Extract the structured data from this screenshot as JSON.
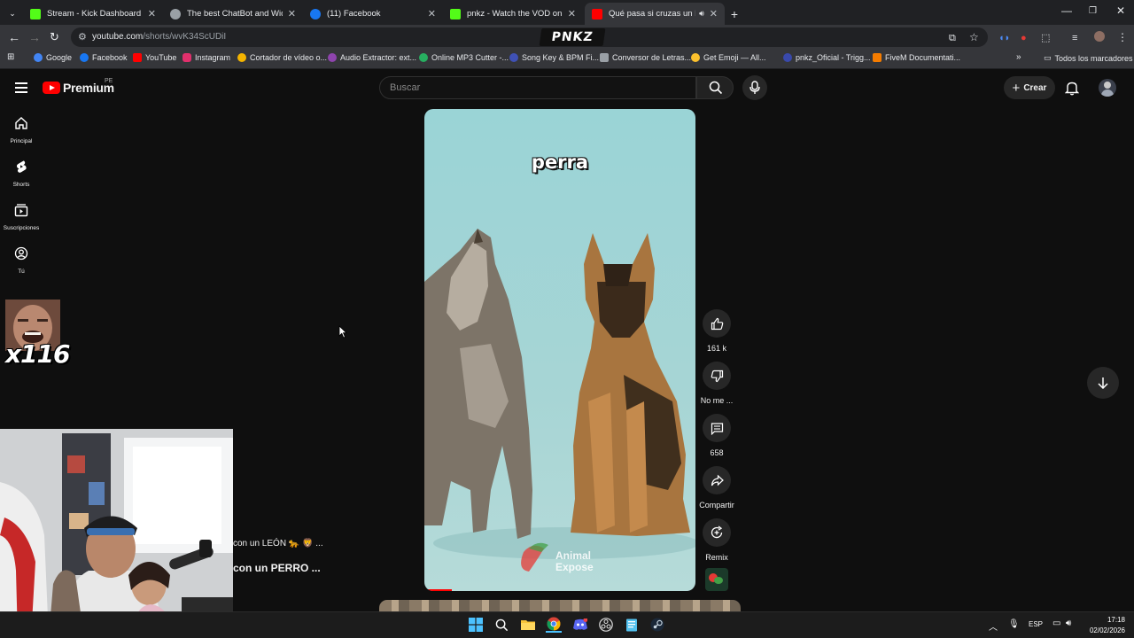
{
  "browser": {
    "tabs": [
      {
        "title": "Stream - Kick Dashboard",
        "icon": "kick-icon",
        "color": "#53fc18"
      },
      {
        "title": "The best ChatBot and Widgets",
        "icon": "botrix-icon",
        "color": "#9aa0a6"
      },
      {
        "title": "(11) Facebook",
        "icon": "facebook-icon",
        "color": "#1877f2"
      },
      {
        "title": "pnkz - Watch the VOD on Kick",
        "icon": "kick-icon",
        "color": "#53fc18"
      },
      {
        "title": "Qué pasa si cruzas un LOBO",
        "icon": "youtube-icon",
        "color": "#ff0000"
      }
    ],
    "new_tab": "+",
    "address": {
      "host": "youtube.com",
      "path": "/shorts/wvK34ScUDiI"
    },
    "overlay_logo": "PNKZ",
    "bookmarks": [
      {
        "label": "Google",
        "color": "#4285f4"
      },
      {
        "label": "Facebook",
        "color": "#1877f2"
      },
      {
        "label": "YouTube",
        "color": "#ff0000"
      },
      {
        "label": "Instagram",
        "color": "#e1306c"
      },
      {
        "label": "Cortador de vídeo o...",
        "color": "#f4b400"
      },
      {
        "label": "Audio Extractor: ext...",
        "color": "#8e44ad"
      },
      {
        "label": "Online MP3 Cutter -...",
        "color": "#27ae60"
      },
      {
        "label": "Song Key & BPM Fi...",
        "color": "#3f51b5"
      },
      {
        "label": "Conversor de Letras...",
        "color": "#9aa0a6"
      },
      {
        "label": "Get Emoji — All...",
        "color": "#fbc02d"
      },
      {
        "label": "pnkz_Oficial - Trigg...",
        "color": "#3949ab"
      },
      {
        "label": "FiveM Documentati...",
        "color": "#f57c00"
      }
    ],
    "all_bookmarks": "Todos los marcadores"
  },
  "youtube": {
    "logo": "Premium",
    "logo_country": "PE",
    "search_placeholder": "Buscar",
    "create_label": "Crear",
    "sidebar": [
      {
        "label": "Principal",
        "icon": "home-icon"
      },
      {
        "label": "Shorts",
        "icon": "shorts-icon"
      },
      {
        "label": "Suscripciones",
        "icon": "subscriptions-icon"
      },
      {
        "label": "Tú",
        "icon": "you-icon"
      }
    ],
    "short": {
      "overlay_text": "perra",
      "watermark": "Animal Expose",
      "progress_fraction": 0.1
    },
    "actions": {
      "like": "161 k",
      "dislike": "No me ...",
      "comments": "658",
      "share": "Compartir",
      "remix": "Remix"
    },
    "recommend": {
      "line1": "con un LEÓN 🐆 🦁 ...",
      "line2": "con un PERRO ..."
    }
  },
  "overlay": {
    "sticker_text": "x116"
  },
  "taskbar": {
    "language": "ESP",
    "time": "17:18",
    "date": "02/02/2026"
  }
}
